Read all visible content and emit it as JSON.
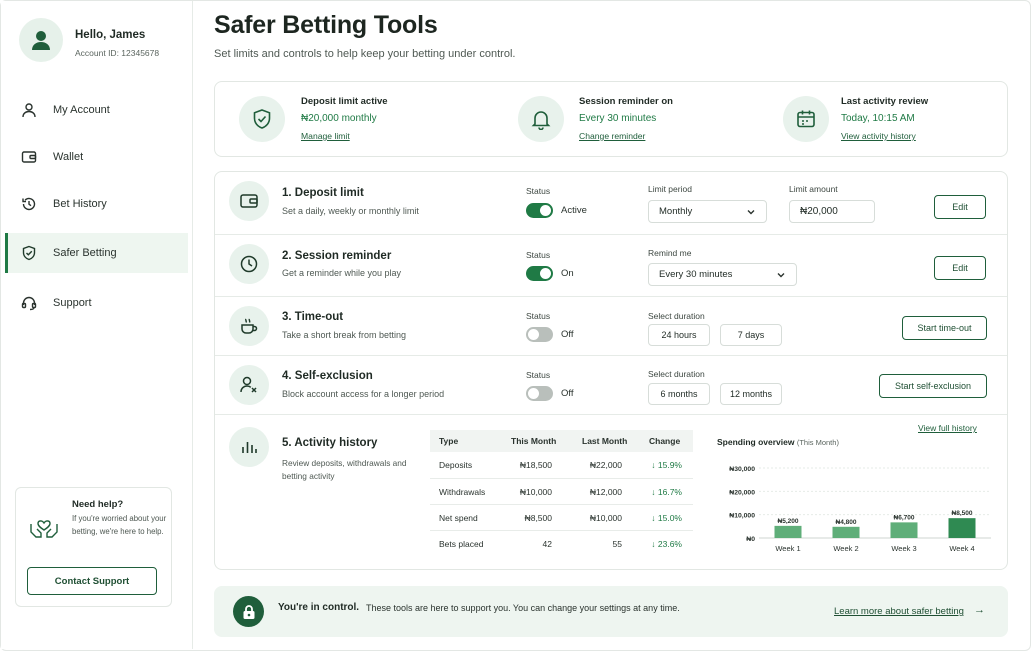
{
  "user": {
    "greeting": "Hello, James",
    "account_id": "Account ID: 12345678"
  },
  "sidebar": {
    "items": [
      {
        "label": "My Account",
        "icon": "user-icon"
      },
      {
        "label": "Wallet",
        "icon": "wallet-icon"
      },
      {
        "label": "Bet History",
        "icon": "history-icon"
      },
      {
        "label": "Safer Betting",
        "icon": "shield-icon",
        "active": true
      },
      {
        "label": "Support",
        "icon": "headset-icon"
      }
    ],
    "help": {
      "title": "Need help?",
      "text": "If you're worried about your betting, we're here to help.",
      "button": "Contact Support"
    }
  },
  "page": {
    "title": "Safer Betting Tools",
    "subtitle": "Set limits and controls to help keep your betting under control."
  },
  "summary": [
    {
      "title": "Deposit limit active",
      "value": "₦20,000 monthly",
      "link": "Manage limit",
      "icon": "shield-check-icon"
    },
    {
      "title": "Session reminder on",
      "value": "Every 30 minutes",
      "link": "Change reminder",
      "icon": "bell-icon"
    },
    {
      "title": "Last activity review",
      "value": "Today, 10:15 AM",
      "link": "View activity history",
      "icon": "calendar-icon"
    }
  ],
  "tools": {
    "deposit": {
      "title": "1. Deposit limit",
      "desc": "Set a daily, weekly or monthly limit",
      "status_label": "Status",
      "status": "Active",
      "period_label": "Limit period",
      "period": "Monthly",
      "amount_label": "Limit amount",
      "amount": "₦20,000",
      "button": "Edit"
    },
    "session": {
      "title": "2. Session reminder",
      "desc": "Get a reminder while you play",
      "status_label": "Status",
      "status": "On",
      "remind_label": "Remind me",
      "remind": "Every 30 minutes",
      "button": "Edit"
    },
    "timeout": {
      "title": "3. Time-out",
      "desc": "Take a short break from betting",
      "status_label": "Status",
      "status": "Off",
      "duration_label": "Select duration",
      "options": [
        "24 hours",
        "7 days"
      ],
      "button": "Start time-out"
    },
    "selfex": {
      "title": "4. Self-exclusion",
      "desc": "Block account access for a longer period",
      "status_label": "Status",
      "status": "Off",
      "duration_label": "Select duration",
      "options": [
        "6 months",
        "12 months"
      ],
      "button": "Start self-exclusion"
    },
    "activity": {
      "title": "5. Activity history",
      "desc_line1": "Review deposits, withdrawals and",
      "desc_line2": "betting activity",
      "view_link": "View full history",
      "table": {
        "headers": [
          "Type",
          "This Month",
          "Last Month",
          "Change"
        ],
        "rows": [
          [
            "Deposits",
            "₦18,500",
            "₦22,000",
            "↓ 15.9%"
          ],
          [
            "Withdrawals",
            "₦10,000",
            "₦12,000",
            "↓ 16.7%"
          ],
          [
            "Net spend",
            "₦8,500",
            "₦10,000",
            "↓ 15.0%"
          ],
          [
            "Bets placed",
            "42",
            "55",
            "↓ 23.6%"
          ]
        ]
      },
      "chart_title": "Spending overview",
      "chart_subtitle": "(This Month)"
    }
  },
  "chart_data": {
    "type": "bar",
    "title": "Spending overview (This Month)",
    "categories": [
      "Week 1",
      "Week 2",
      "Week 3",
      "Week 4"
    ],
    "values": [
      5200,
      4800,
      6700,
      8500
    ],
    "value_labels": [
      "₦5,200",
      "₦4,800",
      "₦6,700",
      "₦8,500"
    ],
    "yticks": [
      "₦0",
      "₦10,000",
      "₦20,000",
      "₦30,000"
    ],
    "ylim": [
      0,
      30000
    ],
    "grid": true,
    "colors": [
      "#5fae79",
      "#5fae79",
      "#5fae79",
      "#2f8a52"
    ]
  },
  "footer": {
    "bold": "You're in control.",
    "text": "These tools are here to support you. You can change your settings at any time.",
    "link": "Learn more about safer betting",
    "arrow": "→"
  },
  "colors": {
    "accent": "#1f7a45",
    "accent_light": "#e8f2ec",
    "dark": "#1f5e3b"
  }
}
